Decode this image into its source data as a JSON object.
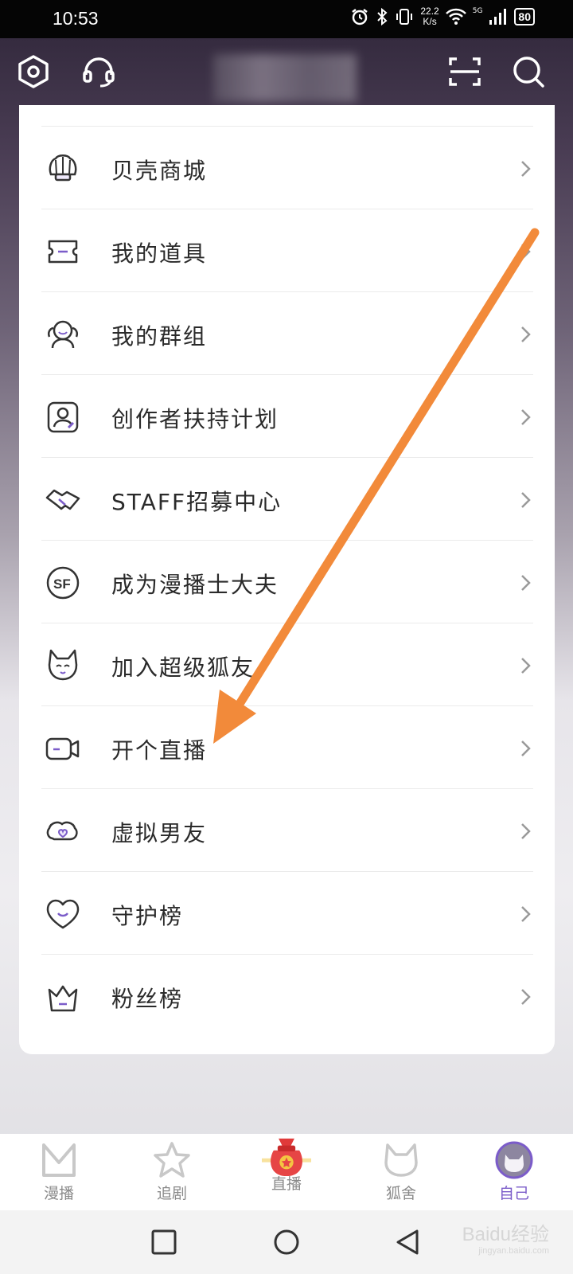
{
  "status_bar": {
    "time": "10:53",
    "net_speed_value": "22.2",
    "net_speed_unit": "K/s",
    "signal_label": "5G",
    "battery": "80"
  },
  "header": {
    "left_icons": [
      "settings-hexagon-icon",
      "headset-icon"
    ],
    "right_icons": [
      "scan-icon",
      "search-icon"
    ]
  },
  "menu": {
    "items": [
      {
        "label": "贝壳商城",
        "icon": "shell-icon"
      },
      {
        "label": "我的道具",
        "icon": "ticket-icon"
      },
      {
        "label": "我的群组",
        "icon": "group-icon"
      },
      {
        "label": "创作者扶持计划",
        "icon": "creator-icon"
      },
      {
        "label": "STAFF招募中心",
        "icon": "handshake-icon"
      },
      {
        "label": "成为漫播士大夫",
        "icon": "sf-badge-icon"
      },
      {
        "label": "加入超级狐友",
        "icon": "fox-icon"
      },
      {
        "label": "开个直播",
        "icon": "camera-icon"
      },
      {
        "label": "虚拟男友",
        "icon": "heart-bubble-icon"
      },
      {
        "label": "守护榜",
        "icon": "heart-icon"
      },
      {
        "label": "粉丝榜",
        "icon": "crown-icon"
      }
    ]
  },
  "tabs": [
    {
      "label": "漫播",
      "icon": "m-logo-icon"
    },
    {
      "label": "追剧",
      "icon": "star-icon"
    },
    {
      "label": "直播",
      "icon": "lucky-bag-icon"
    },
    {
      "label": "狐舍",
      "icon": "fox-head-icon"
    },
    {
      "label": "自己",
      "icon": "avatar-icon"
    }
  ],
  "active_tab": "自己",
  "accent_color": "#7b5cc9",
  "annotation_arrow_color": "#f28a3a",
  "watermark": {
    "brand": "Baidu经验",
    "url": "jingyan.baidu.com"
  }
}
